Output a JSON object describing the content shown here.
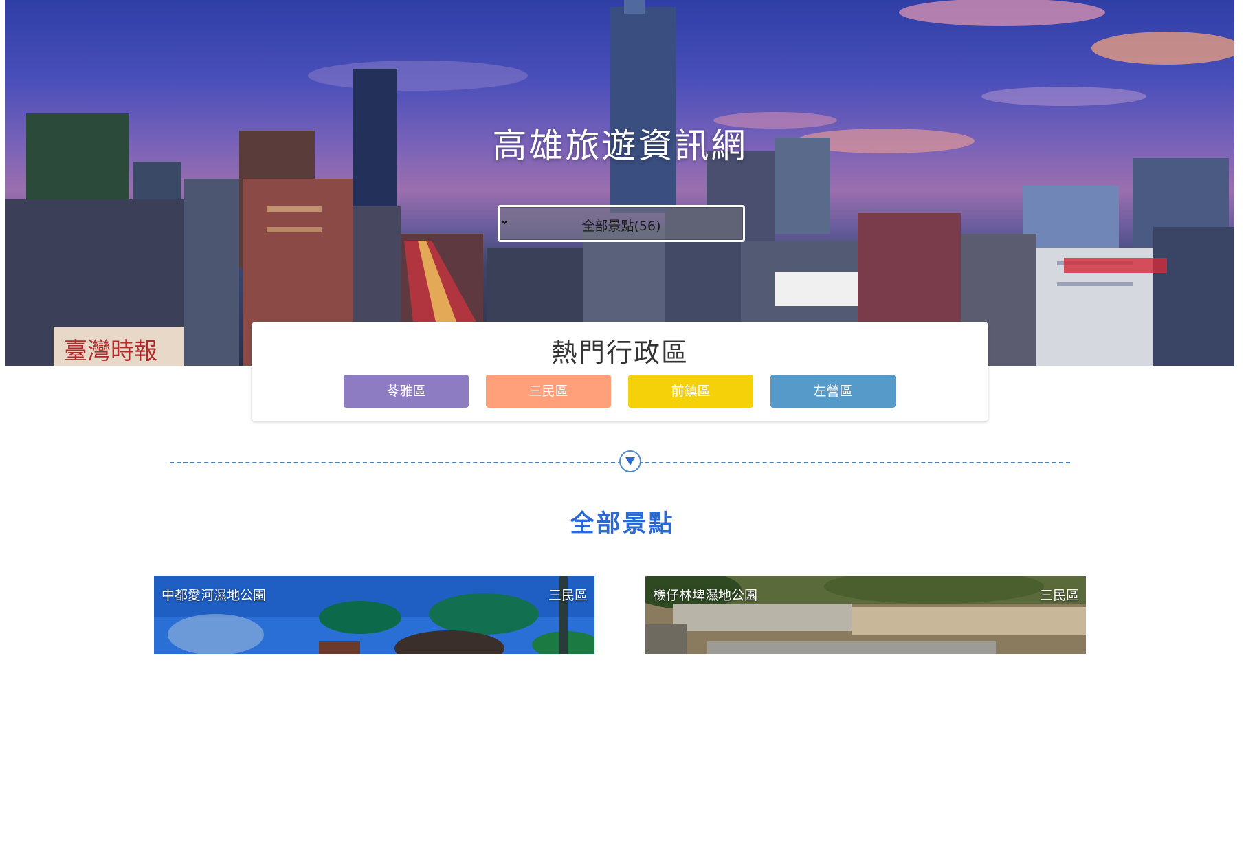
{
  "hero": {
    "title": "高雄旅遊資訊網",
    "select": {
      "selected_value": "全部景點(56)"
    }
  },
  "districts": {
    "title": "熱門行政區",
    "buttons": [
      {
        "label": "苓雅區",
        "color": "#8e7cc3"
      },
      {
        "label": "三民區",
        "color": "#ffa07a"
      },
      {
        "label": "前鎮區",
        "color": "#f5d10a"
      },
      {
        "label": "左營區",
        "color": "#559ac8"
      }
    ]
  },
  "divider": {
    "icon": "triangle-down-icon"
  },
  "section": {
    "title": "全部景點"
  },
  "spots": [
    {
      "name": "中都愛河濕地公園",
      "zone": "三民區"
    },
    {
      "name": "檨仔林埤濕地公園",
      "zone": "三民區"
    }
  ],
  "colors": {
    "accent": "#2a6ad4",
    "divider": "#4f7fb4"
  }
}
